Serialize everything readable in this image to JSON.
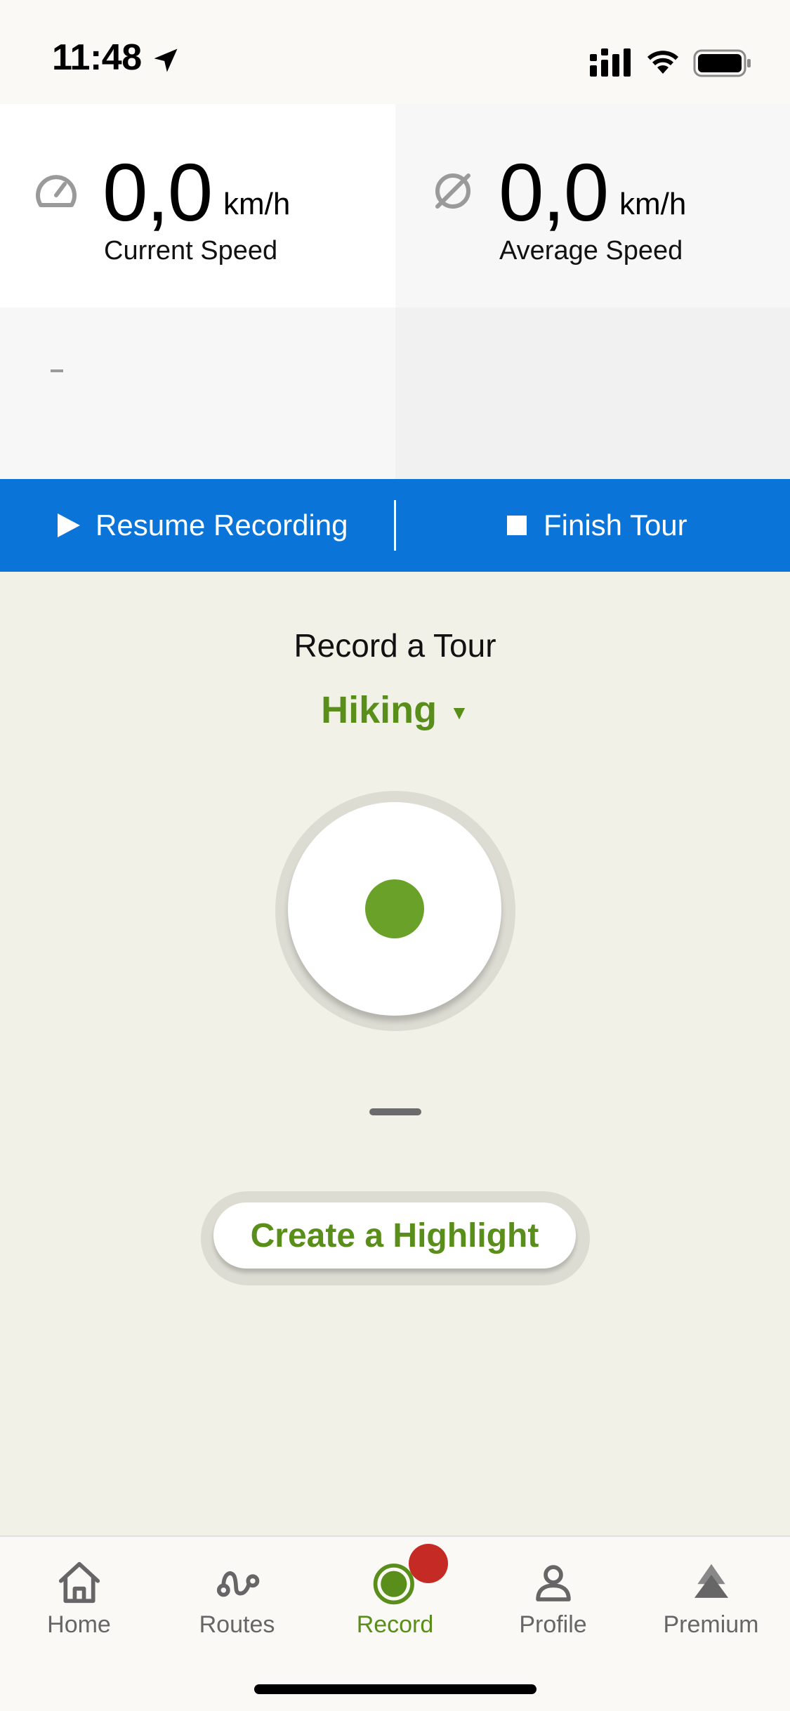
{
  "status_bar": {
    "time": "11:48",
    "icons": [
      "location-arrow-icon",
      "signal-icon",
      "wifi-icon",
      "battery-icon"
    ]
  },
  "stats": {
    "current_speed": {
      "value": "0,0",
      "unit": "km/h",
      "label": "Current Speed",
      "icon": "speedometer-icon"
    },
    "average_speed": {
      "value": "0,0",
      "unit": "km/h",
      "label": "Average Speed",
      "icon": "average-icon"
    }
  },
  "recording_bar": {
    "resume_label": "Resume Recording",
    "finish_label": "Finish Tour",
    "background": "#0a74d8"
  },
  "record": {
    "title": "Record a Tour",
    "activity": "Hiking",
    "caret": "▼",
    "accent": "#5a8e1a",
    "highlight_label": "Create a Highlight"
  },
  "tabs": [
    {
      "label": "Home",
      "icon": "home-icon",
      "active": false
    },
    {
      "label": "Routes",
      "icon": "routes-icon",
      "active": false
    },
    {
      "label": "Record",
      "icon": "record-icon",
      "active": true
    },
    {
      "label": "Profile",
      "icon": "profile-icon",
      "active": false
    },
    {
      "label": "Premium",
      "icon": "premium-icon",
      "active": false
    }
  ],
  "badge_color": "#c62a24"
}
